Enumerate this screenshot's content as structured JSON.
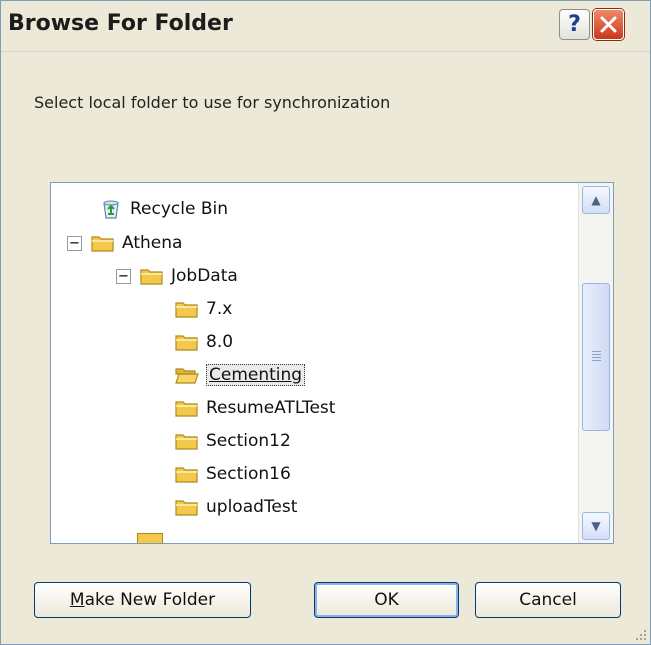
{
  "window": {
    "title": "Browse For Folder",
    "help_glyph": "?",
    "close_glyph": "✕"
  },
  "prompt": "Select local folder to use for synchronization",
  "tree": {
    "items": [
      {
        "label": "Recycle Bin",
        "icon": "recycle-bin-icon"
      },
      {
        "label": "Athena",
        "icon": "folder-icon",
        "expander": "−"
      },
      {
        "label": "JobData",
        "icon": "folder-icon",
        "expander": "−"
      },
      {
        "label": "7.x",
        "icon": "folder-icon"
      },
      {
        "label": "8.0",
        "icon": "folder-icon"
      },
      {
        "label": "Cementing",
        "icon": "folder-icon",
        "selected": true
      },
      {
        "label": "ResumeATLTest",
        "icon": "folder-icon"
      },
      {
        "label": "Section12",
        "icon": "folder-icon"
      },
      {
        "label": "Section16",
        "icon": "folder-icon"
      },
      {
        "label": "uploadTest",
        "icon": "folder-icon"
      }
    ],
    "scroll_up_glyph": "▲",
    "scroll_down_glyph": "▼"
  },
  "buttons": {
    "make_new_folder_prefix": "M",
    "make_new_folder_rest": "ake New Folder",
    "ok": "OK",
    "cancel": "Cancel"
  },
  "colors": {
    "frame": "#ece9d8",
    "border": "#7f9db9",
    "folder": "#f4c84b",
    "close": "#d0482a"
  }
}
